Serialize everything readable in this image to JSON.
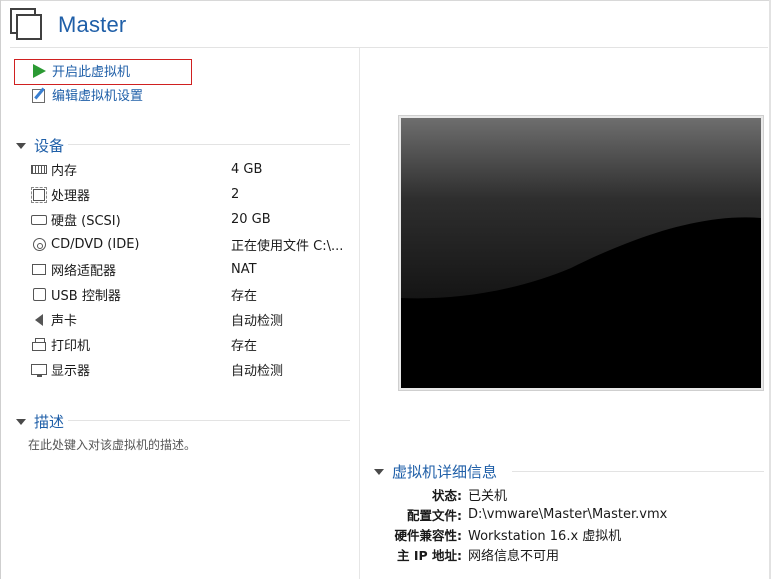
{
  "vm": {
    "title": "Master"
  },
  "actions": {
    "power_on": "开启此虚拟机",
    "edit_settings": "编辑虚拟机设置"
  },
  "devices_section": {
    "title": "设备",
    "items": [
      {
        "name": "内存",
        "value": "4 GB",
        "icon": "memory-icon"
      },
      {
        "name": "处理器",
        "value": "2",
        "icon": "cpu-icon"
      },
      {
        "name": "硬盘 (SCSI)",
        "value": "20 GB",
        "icon": "hard-disk-icon"
      },
      {
        "name": "CD/DVD (IDE)",
        "value": "正在使用文件 C:\\...",
        "icon": "cd-dvd-icon"
      },
      {
        "name": "网络适配器",
        "value": "NAT",
        "icon": "network-adapter-icon"
      },
      {
        "name": "USB 控制器",
        "value": "存在",
        "icon": "usb-icon"
      },
      {
        "name": "声卡",
        "value": "自动检测",
        "icon": "speaker-icon"
      },
      {
        "name": "打印机",
        "value": "存在",
        "icon": "printer-icon"
      },
      {
        "name": "显示器",
        "value": "自动检测",
        "icon": "display-icon"
      }
    ]
  },
  "description_section": {
    "title": "描述",
    "placeholder": "在此处键入对该虚拟机的描述。"
  },
  "details_section": {
    "title": "虚拟机详细信息",
    "rows": [
      {
        "label": "状态:",
        "value": "已关机"
      },
      {
        "label": "配置文件:",
        "value": "D:\\vmware\\Master\\Master.vmx"
      },
      {
        "label": "硬件兼容性:",
        "value": "Workstation 16.x 虚拟机"
      },
      {
        "label": "主 IP 地址:",
        "value": "网络信息不可用"
      }
    ]
  },
  "colors": {
    "accent": "#1f5fa8",
    "play_green": "#2b9a33",
    "highlight_red": "#d02020"
  }
}
